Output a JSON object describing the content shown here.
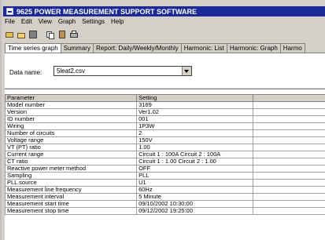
{
  "window": {
    "title": "9625 POWER MEASUREMENT SUPPORT SOFTWARE"
  },
  "menu": [
    "File",
    "Edit",
    "View",
    "Graph",
    "Settings",
    "Help"
  ],
  "toolbar_icons": [
    "open-icon",
    "folder-icon",
    "save-icon",
    "copy-icon",
    "paste-icon",
    "print-icon"
  ],
  "tabs": [
    "Time series graph",
    "Summary",
    "Report: Daily/Weekly/Monthly",
    "Harmonic: List",
    "Harmonic: Graph",
    "Harmo"
  ],
  "data_name": {
    "label": "Data name:",
    "value": "5leat2.csv"
  },
  "grid": {
    "headers": [
      "Parameter",
      "Setting"
    ],
    "rows": [
      [
        "Model number",
        "3169"
      ],
      [
        "Version",
        "Ver1.02"
      ],
      [
        "ID number",
        "001"
      ],
      [
        "Wiring",
        "1P3W"
      ],
      [
        "Number of circuits",
        "2"
      ],
      [
        "Voltage range",
        "150V"
      ],
      [
        "VT (PT) ratio",
        "1.00"
      ],
      [
        "Current range",
        "Circuit 1 : 100A  Circuit 2 : 100A"
      ],
      [
        "CT ratio",
        "Circuit 1 : 1.00  Circuit 2 : 1.00"
      ],
      [
        "Reactive power meter method",
        "OFF"
      ],
      [
        "Sampling",
        "PLL"
      ],
      [
        "PLL source",
        "U1"
      ],
      [
        "Measurement line frequency",
        "60Hz"
      ],
      [
        "Measurement interval",
        "5 Minute"
      ],
      [
        "Measurement start time",
        "09/10/2002 10:30:00"
      ],
      [
        "Measurement stop time",
        "09/12/2002 19:25:00"
      ]
    ]
  },
  "colors": {
    "titlebar": "#1c2a98",
    "chrome": "#d4d0c8"
  }
}
